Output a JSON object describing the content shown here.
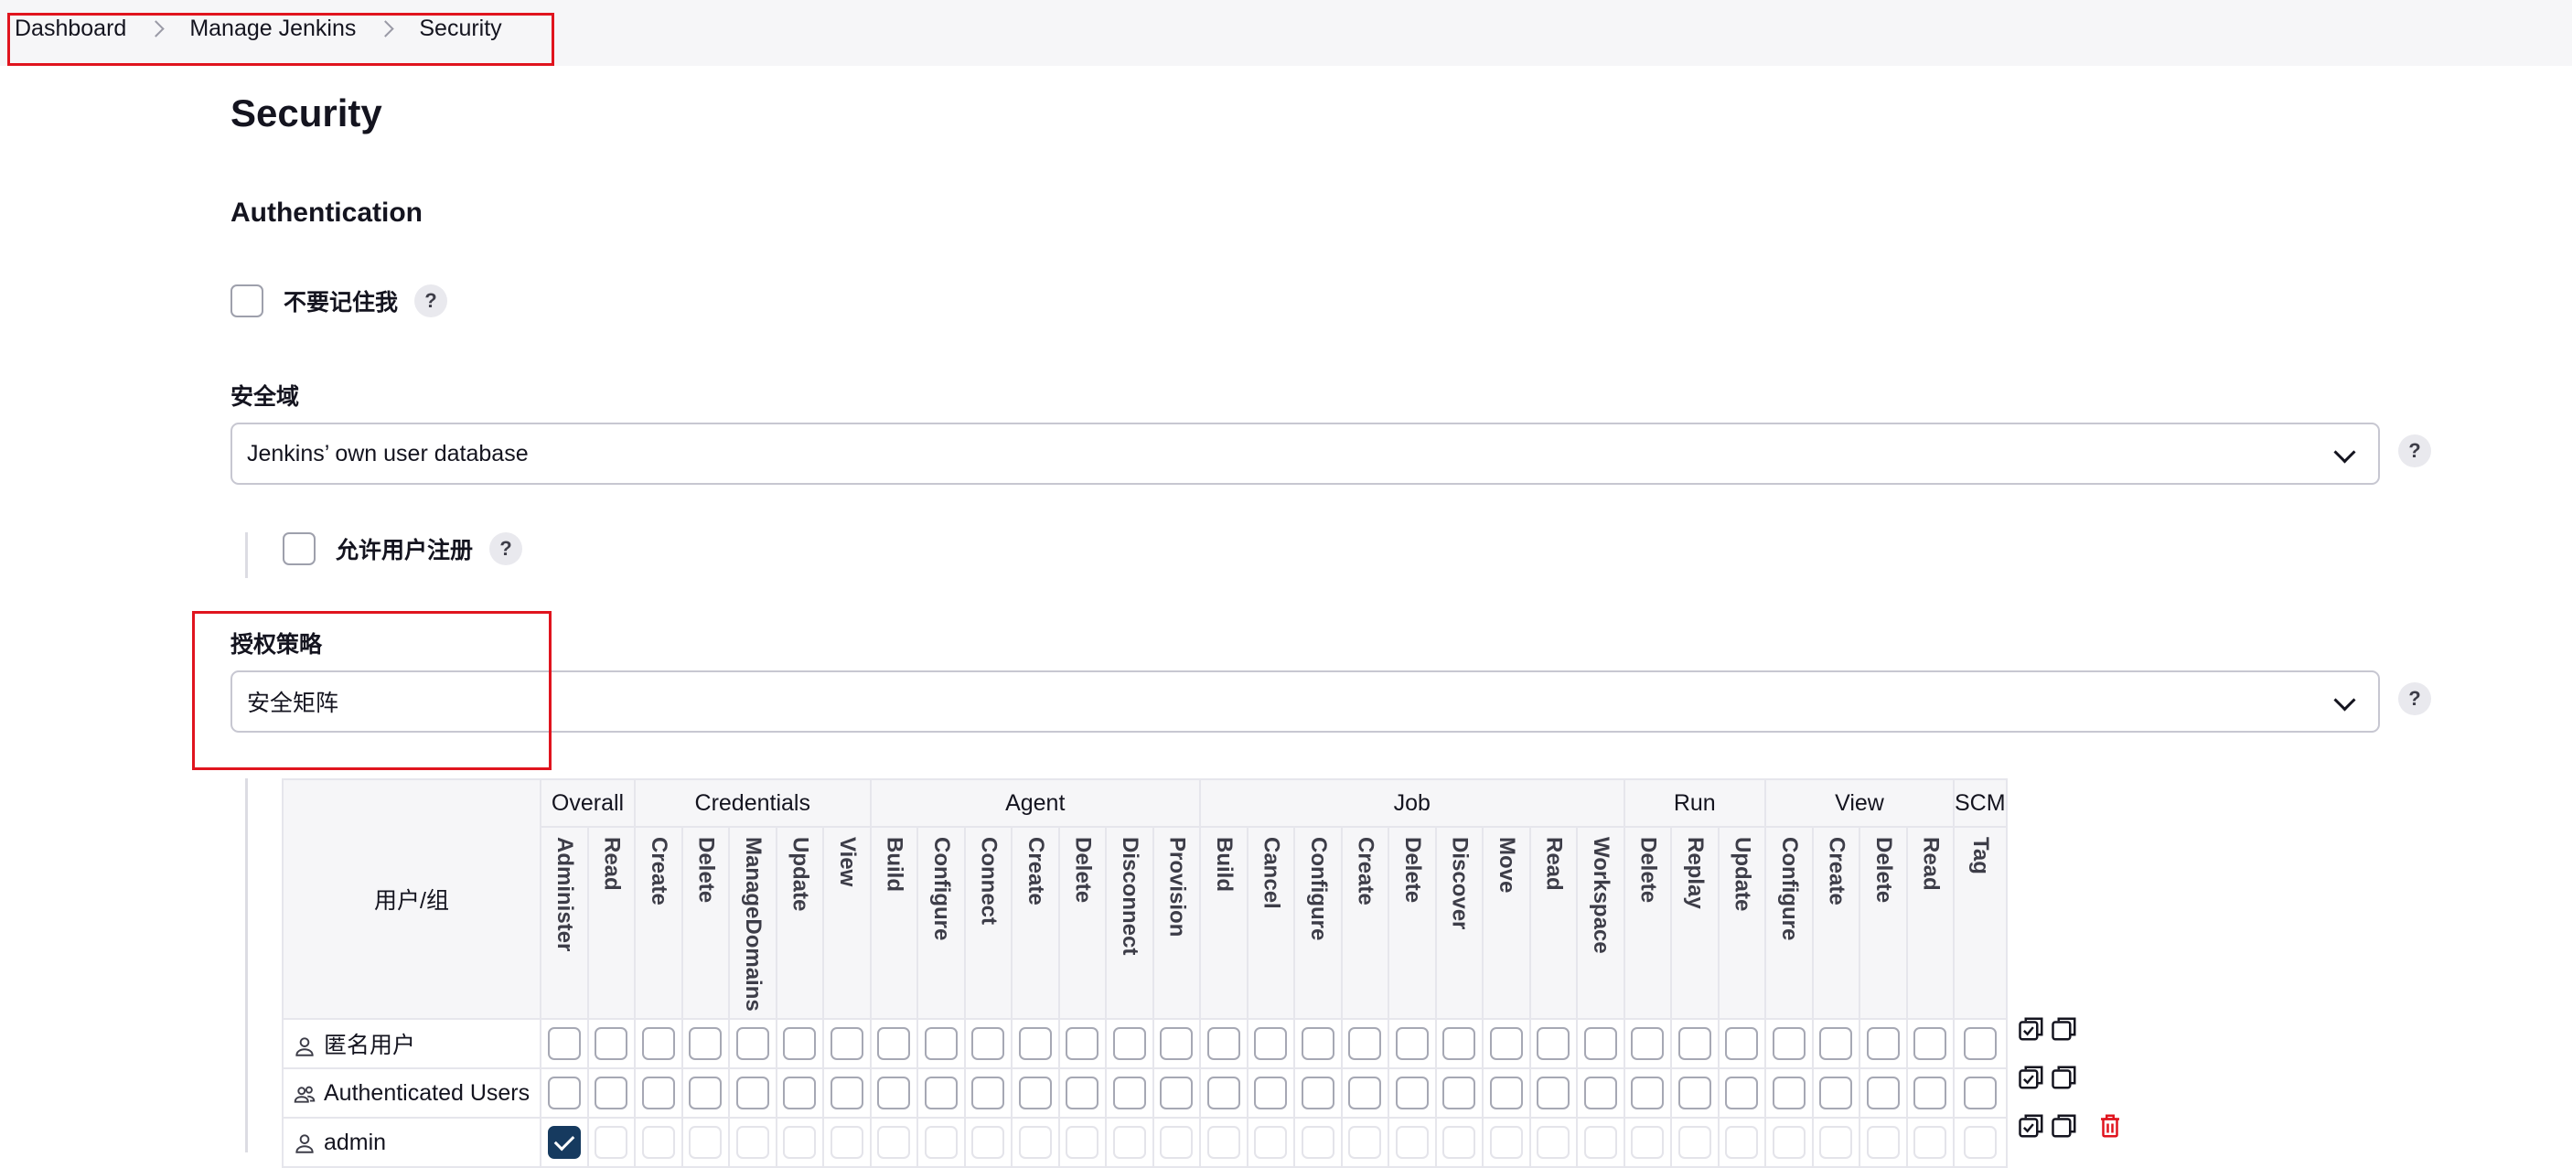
{
  "breadcrumb": [
    "Dashboard",
    "Manage Jenkins",
    "Security"
  ],
  "page_title": "Security",
  "section_title": "Authentication",
  "remember_me": {
    "label": "不要记住我",
    "checked": false
  },
  "security_realm": {
    "label": "安全域",
    "value": "Jenkins’ own user database"
  },
  "allow_signup": {
    "label": "允许用户注册",
    "checked": false
  },
  "authorization": {
    "label": "授权策略",
    "value": "安全矩阵"
  },
  "help_text": "?",
  "matrix": {
    "user_header": "用户/组",
    "groups": [
      {
        "name": "Overall",
        "perms": [
          "Administer",
          "Read"
        ]
      },
      {
        "name": "Credentials",
        "perms": [
          "Create",
          "Delete",
          "ManageDomains",
          "Update",
          "View"
        ]
      },
      {
        "name": "Agent",
        "perms": [
          "Build",
          "Configure",
          "Connect",
          "Create",
          "Delete",
          "Disconnect",
          "Provision"
        ]
      },
      {
        "name": "Job",
        "perms": [
          "Build",
          "Cancel",
          "Configure",
          "Create",
          "Delete",
          "Discover",
          "Move",
          "Read",
          "Workspace"
        ]
      },
      {
        "name": "Run",
        "perms": [
          "Delete",
          "Replay",
          "Update"
        ]
      },
      {
        "name": "View",
        "perms": [
          "Configure",
          "Create",
          "Delete",
          "Read"
        ]
      },
      {
        "name": "SCM",
        "perms": [
          "Tag"
        ]
      }
    ],
    "rows": [
      {
        "name": "匿名用户",
        "icon": "user-icon",
        "checked": [],
        "dim": false,
        "deletable": false
      },
      {
        "name": "Authenticated Users",
        "icon": "users-icon",
        "checked": [],
        "dim": false,
        "deletable": false
      },
      {
        "name": "admin",
        "icon": "user-icon",
        "checked": [
          0
        ],
        "dim": true,
        "deletable": true
      }
    ]
  },
  "colors": {
    "accent": "#163a5f",
    "highlight": "#e0141e",
    "delete": "#e0141e"
  }
}
